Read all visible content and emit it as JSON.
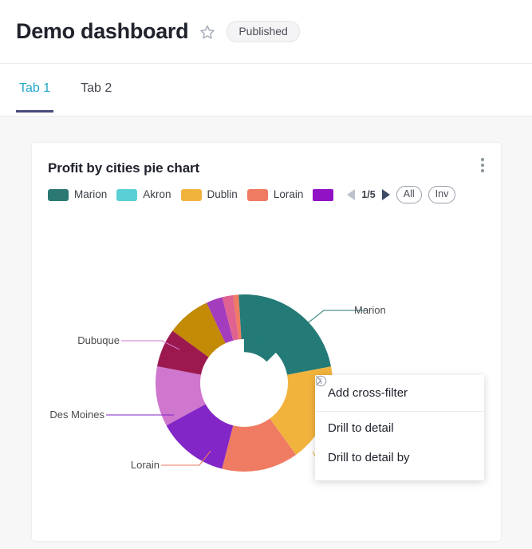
{
  "header": {
    "title": "Demo dashboard",
    "favorite_icon": "star-outline-icon",
    "status_badge": "Published"
  },
  "tabs": [
    {
      "label": "Tab 1",
      "active": true
    },
    {
      "label": "Tab 2",
      "active": false
    }
  ],
  "card": {
    "title": "Profit by cities pie chart",
    "menu_icon": "kebab-menu-icon"
  },
  "legend": {
    "items": [
      {
        "label": "Marion",
        "color": "#2c7873"
      },
      {
        "label": "Akron",
        "color": "#5ad0d5"
      },
      {
        "label": "Dublin",
        "color": "#f2b33d"
      },
      {
        "label": "Lorain",
        "color": "#ef7b63"
      },
      {
        "label": "",
        "color": "#9112c4"
      }
    ],
    "pager": {
      "prev_icon": "triangle-left-icon",
      "next_icon": "triangle-right-icon",
      "page_indicator": "1/5"
    },
    "all_button": "All",
    "invert_button": "Inv"
  },
  "context_menu": {
    "items": [
      {
        "label": "Add cross-filter",
        "icon": "info-circle-icon",
        "has_chevron": false
      },
      {
        "label": "Drill to detail",
        "icon": "",
        "has_chevron": false
      },
      {
        "label": "Drill to detail by",
        "icon": "",
        "has_chevron": true,
        "chevron_icon": "chevron-right-icon"
      }
    ]
  },
  "chart_data": {
    "type": "pie",
    "title": "Profit by cities pie chart",
    "donut": true,
    "legend_position": "top",
    "labels": [
      "Marion",
      "Dublin",
      "Lorain",
      "Des Moines",
      "Dubuque"
    ],
    "categories": [
      "Marion",
      "Dublin",
      "Lorain",
      "Des Moines",
      "Dubuque",
      "slice-6",
      "slice-7",
      "slice-8",
      "slice-9",
      "slice-10",
      "slice-11"
    ],
    "values": [
      22,
      18,
      14,
      13,
      11,
      7,
      8,
      3,
      2,
      1,
      1
    ],
    "colors": [
      "#237a76",
      "#f2b33d",
      "#ef7b63",
      "#8226c7",
      "#cf76ce",
      "#9c1950",
      "#c28a05",
      "#a33dbd",
      "#e06291",
      "#ef7b63",
      "#237a76"
    ],
    "callout_labels": [
      {
        "text": "Marion",
        "color": "#237a76"
      },
      {
        "text": "Dubuque",
        "color": "#cf76ce"
      },
      {
        "text": "Des Moines",
        "color": "#8226c7"
      },
      {
        "text": "Lorain",
        "color": "#ef7b63"
      },
      {
        "text": "Dublin",
        "color": "#f2b33d"
      }
    ]
  }
}
